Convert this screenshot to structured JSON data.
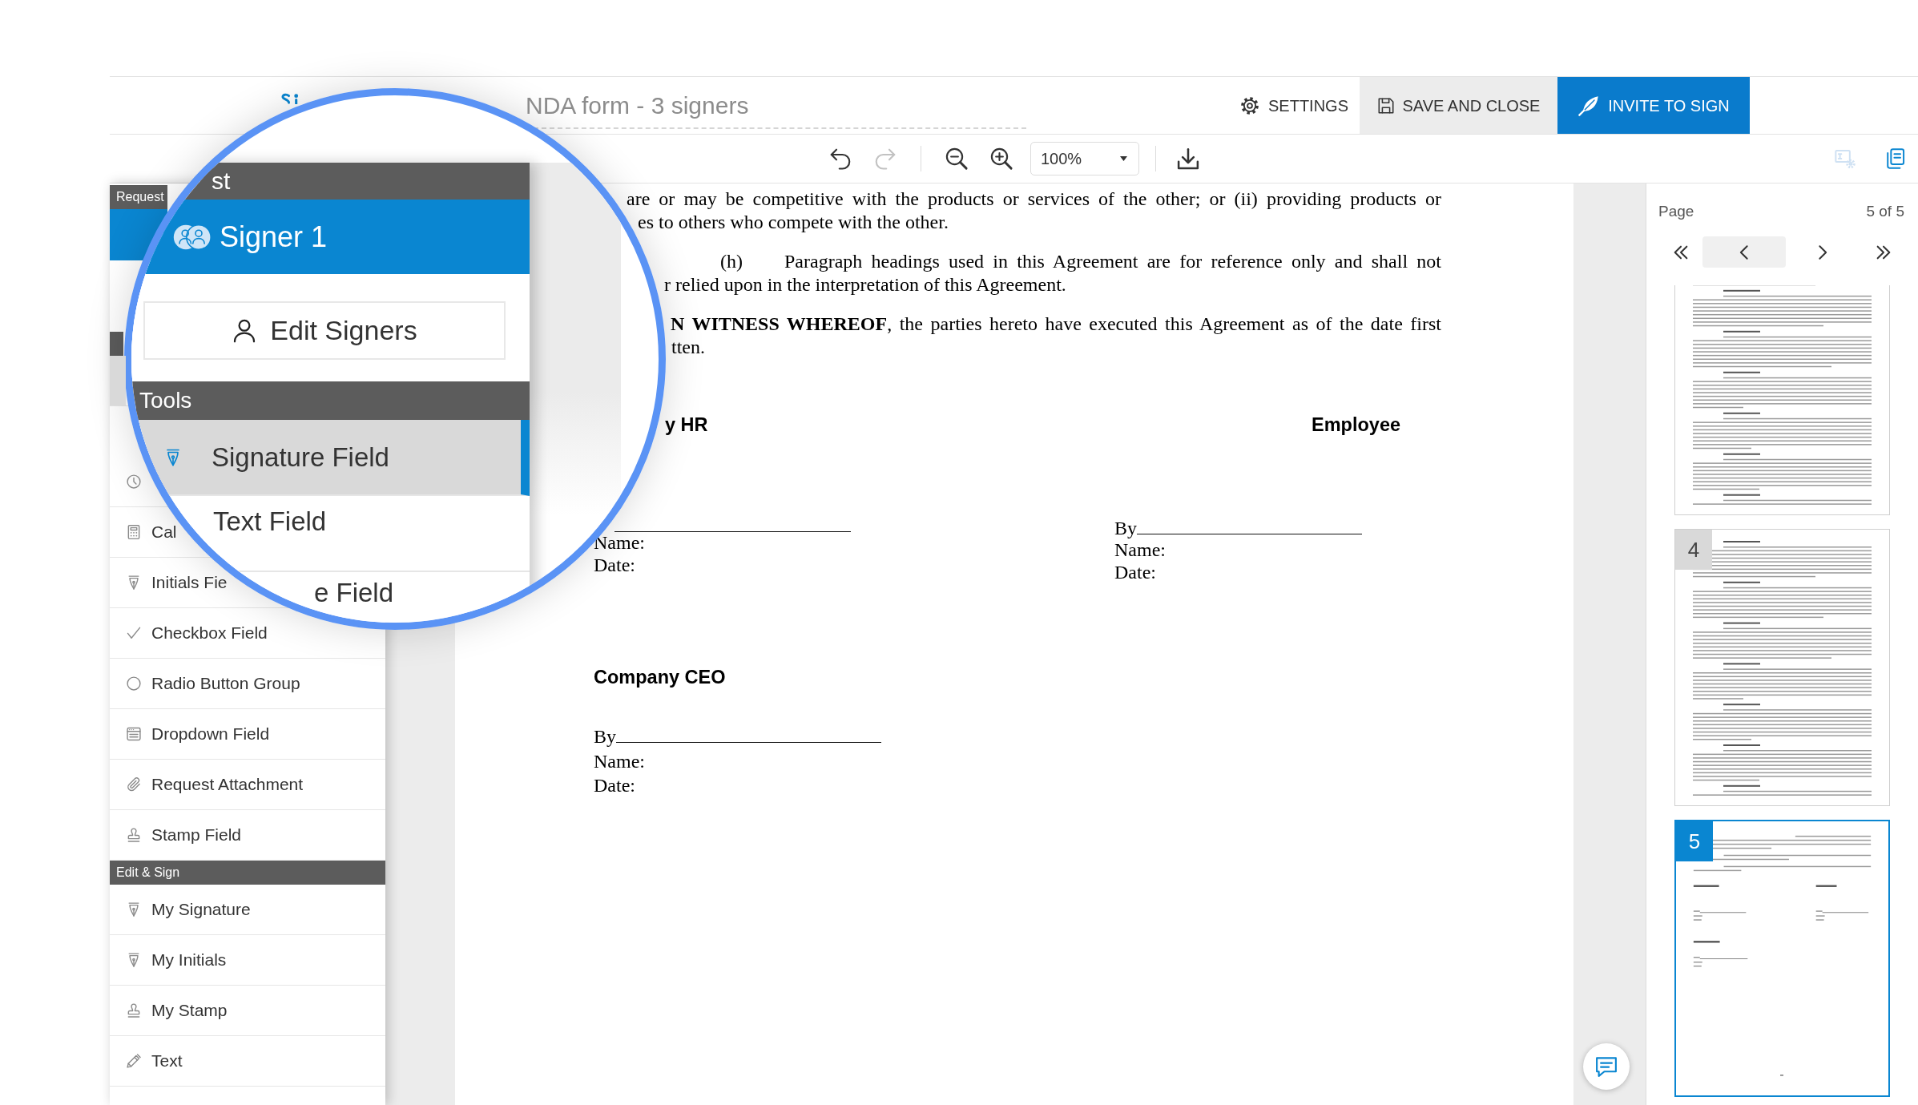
{
  "header": {
    "title": "NDA form - 3 signers",
    "settings": "SETTINGS",
    "save": "SAVE AND CLOSE",
    "invite": "INVITE TO SIGN"
  },
  "toolbar": {
    "undo": {
      "disabled": false
    },
    "redo": {
      "disabled": true
    },
    "zoom": "100%",
    "side_tools": [
      {
        "disabled": true
      },
      {
        "disabled": false
      }
    ]
  },
  "sidebar": {
    "groups": [
      {
        "title": "Request",
        "items": [
          {
            "kind": "signer",
            "selected": true
          }
        ]
      },
      {
        "items": [
          {
            "selected": true
          },
          {
            "kind": "date",
            "selected": false
          },
          {
            "kind": "calculated",
            "label": "Cal",
            "selected": false
          },
          {
            "kind": "initials",
            "label": "Initials Fie",
            "selected": false
          },
          {
            "kind": "checkbox",
            "label": "Checkbox Field",
            "selected": false
          },
          {
            "kind": "radio",
            "label": "Radio Button Group",
            "selected": false
          },
          {
            "kind": "dropdown",
            "label": "Dropdown Field",
            "selected": false
          },
          {
            "kind": "attachment",
            "label": "Request Attachment",
            "selected": false
          },
          {
            "kind": "stamp",
            "label": "Stamp Field",
            "selected": false
          }
        ]
      },
      {
        "title": "Edit & Sign",
        "items": [
          {
            "kind": "signature",
            "label": "My Signature",
            "selected": false
          },
          {
            "kind": "initials",
            "label": "My Initials",
            "selected": false
          },
          {
            "kind": "stamp",
            "label": "My Stamp",
            "selected": false
          },
          {
            "kind": "text",
            "label": "Text",
            "selected": false
          }
        ]
      }
    ]
  },
  "magnifier": {
    "header": "st",
    "signer": {
      "name": "Signer 1",
      "selected": true
    },
    "edit_button": "Edit Signers",
    "tools_title": "Tools",
    "tools": [
      {
        "kind": "signature",
        "label": "Signature Field",
        "selected": true
      },
      {
        "label": "Text Field",
        "selected": false
      },
      {
        "label": "e Field",
        "selected": false
      }
    ]
  },
  "document": {
    "paragraphs": [
      {
        "lines": [
          "are or may be competitive with the products or services of the other; or (ii) providing products or",
          "es to others who compete with the other."
        ]
      },
      {
        "marker": "(h)",
        "lines": [
          "Paragraph headings used in this Agreement are for reference only and shall not",
          "r relied upon in the interpretation of this Agreement."
        ]
      },
      {
        "lines": [
          "**N WITNESS WHEREOF**, the parties hereto have executed this Agreement as of the date first",
          "tten."
        ]
      }
    ],
    "signature_rows": [
      [
        {
          "title": "y HR",
          "lines": [
            "Name:",
            "Date:"
          ]
        },
        {
          "title": "Employee",
          "by": "By",
          "lines": [
            "Name:",
            "Date:"
          ]
        }
      ],
      [
        {
          "title": "Company CEO",
          "by": "By",
          "lines": [
            "Name:",
            "Date:"
          ]
        }
      ]
    ]
  },
  "pages_panel": {
    "label": "Page",
    "count": "5 of 5",
    "nav": [
      {
        "highlighted": false
      },
      {
        "highlighted": true
      },
      {
        "highlighted": false
      },
      {
        "highlighted": false
      }
    ],
    "thumbnails": [
      {
        "kind": "text",
        "selected": false
      },
      {
        "kind": "text",
        "label": "4",
        "selected": false
      },
      {
        "kind": "signatures",
        "label": "5",
        "selected": true
      }
    ]
  }
}
